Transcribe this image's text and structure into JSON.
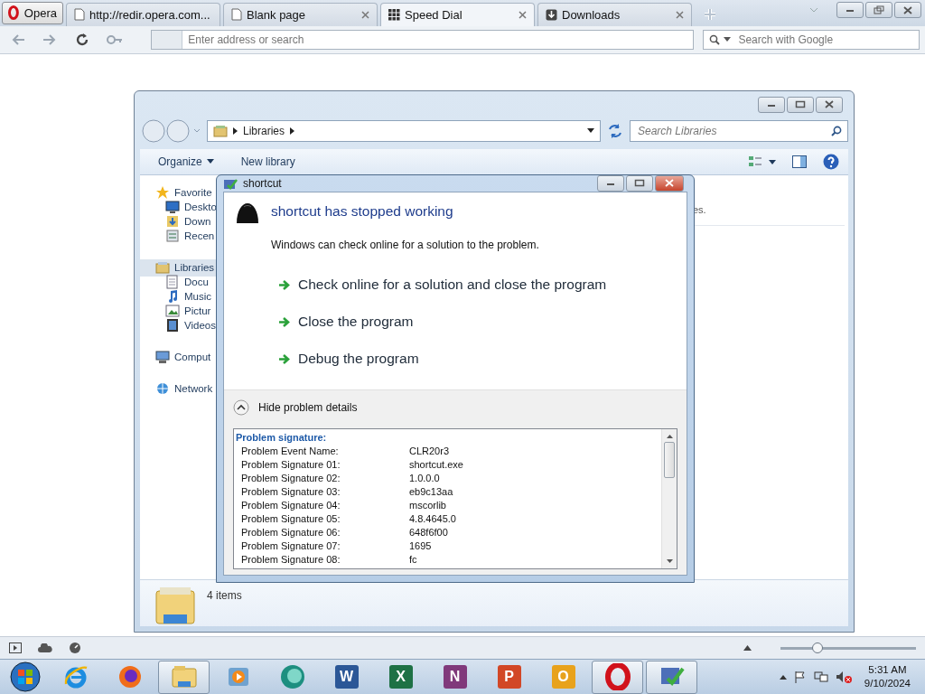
{
  "browser": {
    "opera_button": "Opera",
    "tabs": [
      {
        "title": "http://redir.opera.com...",
        "kind": "page",
        "selected": false
      },
      {
        "title": "Blank page",
        "kind": "page",
        "selected": false
      },
      {
        "title": "Speed Dial",
        "kind": "grid",
        "selected": true
      },
      {
        "title": "Downloads",
        "kind": "download",
        "selected": false
      }
    ],
    "address": {
      "placeholder": "Enter address or search"
    },
    "search": {
      "placeholder": "Search with Google"
    }
  },
  "explorer": {
    "breadcrumb": "Libraries",
    "search": {
      "placeholder": "Search Libraries"
    },
    "toolbar": [
      {
        "label": "Organize",
        "menu": true
      },
      {
        "label": "New library",
        "menu": false
      }
    ],
    "nav": [
      {
        "label": "Favorite",
        "kind": "star",
        "selected": false,
        "children": [
          {
            "label": "Deskto",
            "kind": "desktop",
            "selected": false
          },
          {
            "label": "Down",
            "kind": "download",
            "selected": false
          },
          {
            "label": "Recen",
            "kind": "recent",
            "selected": false
          }
        ]
      },
      {
        "label": "Libraries",
        "kind": "library",
        "selected": true,
        "children": [
          {
            "label": "Docu",
            "kind": "document",
            "selected": false
          },
          {
            "label": "Music",
            "kind": "music",
            "selected": false
          },
          {
            "label": "Pictur",
            "kind": "picture",
            "selected": false
          },
          {
            "label": "Videos",
            "kind": "video",
            "selected": false
          }
        ]
      },
      {
        "label": "Comput",
        "kind": "computer",
        "selected": false
      },
      {
        "label": "Network",
        "kind": "network",
        "selected": false
      }
    ],
    "content_fragment": "es.",
    "status": "4 items"
  },
  "dialog": {
    "title": "shortcut",
    "heading": "shortcut has stopped working",
    "message": "Windows can check online for a solution to the problem.",
    "commands": [
      "Check online for a solution and close the program",
      "Close the program",
      "Debug the program"
    ],
    "details": {
      "toggle": "Hide problem details",
      "expanded": true,
      "heading": "Problem signature:",
      "rows": [
        {
          "label": "Problem Event Name:",
          "value": "CLR20r3"
        },
        {
          "label": "Problem Signature 01:",
          "value": "shortcut.exe"
        },
        {
          "label": "Problem Signature 02:",
          "value": "1.0.0.0"
        },
        {
          "label": "Problem Signature 03:",
          "value": "eb9c13aa"
        },
        {
          "label": "Problem Signature 04:",
          "value": "mscorlib"
        },
        {
          "label": "Problem Signature 05:",
          "value": "4.8.4645.0"
        },
        {
          "label": "Problem Signature 06:",
          "value": "648f6f00"
        },
        {
          "label": "Problem Signature 07:",
          "value": "1695"
        },
        {
          "label": "Problem Signature 08:",
          "value": "fc"
        }
      ]
    }
  },
  "status_bar": {
    "zoom": {
      "level": 0.27
    }
  },
  "taskbar": {
    "items": [
      {
        "kind": "ie",
        "selected": false
      },
      {
        "kind": "firefox",
        "selected": false
      },
      {
        "kind": "folder",
        "selected": true
      },
      {
        "kind": "media",
        "selected": false
      },
      {
        "kind": "teal",
        "selected": false
      },
      {
        "kind": "office",
        "glyph": "W",
        "color": "#2b5797",
        "selected": false
      },
      {
        "kind": "office",
        "glyph": "X",
        "color": "#1e7145",
        "selected": false
      },
      {
        "kind": "office",
        "glyph": "N",
        "color": "#80397b",
        "selected": false
      },
      {
        "kind": "office",
        "glyph": "P",
        "color": "#d24726",
        "selected": false
      },
      {
        "kind": "office",
        "glyph": "O",
        "color": "#e8a21c",
        "selected": false
      },
      {
        "kind": "opera",
        "selected": true
      },
      {
        "kind": "tool",
        "selected": true
      }
    ],
    "clock": {
      "time": "5:31 AM",
      "date": "9/10/2024"
    }
  }
}
